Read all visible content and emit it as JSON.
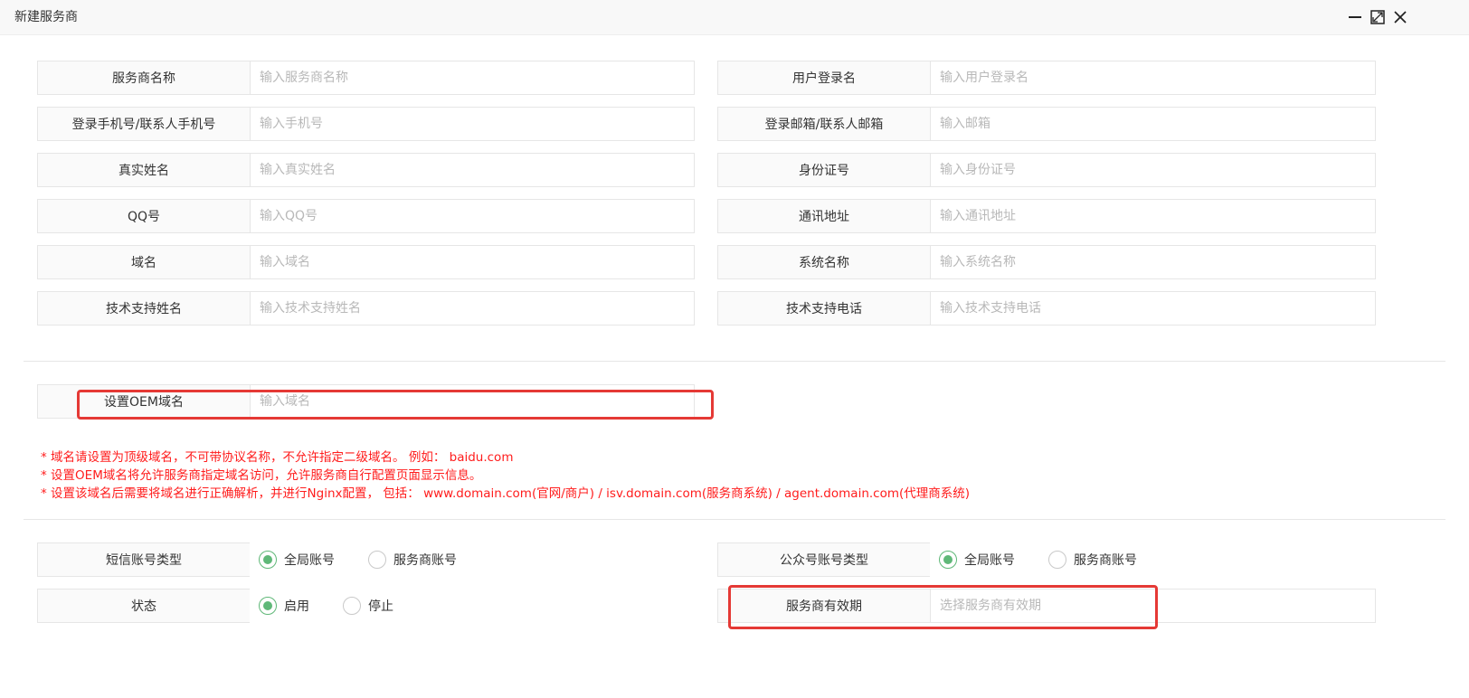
{
  "window": {
    "title": "新建服务商"
  },
  "form": {
    "rows": [
      {
        "left": {
          "label": "服务商名称",
          "placeholder": "输入服务商名称"
        },
        "right": {
          "label": "用户登录名",
          "placeholder": "输入用户登录名"
        }
      },
      {
        "left": {
          "label": "登录手机号/联系人手机号",
          "placeholder": "输入手机号"
        },
        "right": {
          "label": "登录邮箱/联系人邮箱",
          "placeholder": "输入邮箱"
        }
      },
      {
        "left": {
          "label": "真实姓名",
          "placeholder": "输入真实姓名"
        },
        "right": {
          "label": "身份证号",
          "placeholder": "输入身份证号"
        }
      },
      {
        "left": {
          "label": "QQ号",
          "placeholder": "输入QQ号"
        },
        "right": {
          "label": "通讯地址",
          "placeholder": "输入通讯地址"
        }
      },
      {
        "left": {
          "label": "域名",
          "placeholder": "输入域名"
        },
        "right": {
          "label": "系统名称",
          "placeholder": "输入系统名称"
        }
      },
      {
        "left": {
          "label": "技术支持姓名",
          "placeholder": "输入技术支持姓名"
        },
        "right": {
          "label": "技术支持电话",
          "placeholder": "输入技术支持电话"
        }
      }
    ],
    "oem": {
      "label": "设置OEM域名",
      "placeholder": "输入域名",
      "notes": [
        "* 域名请设置为顶级域名，不可带协议名称，不允许指定二级域名。 例如： baidu.com",
        "* 设置OEM域名将允许服务商指定域名访问，允许服务商自行配置页面显示信息。",
        "* 设置该域名后需要将域名进行正确解析，并进行Nginx配置， 包括： www.domain.com(官网/商户) / isv.domain.com(服务商系统) / agent.domain.com(代理商系统)"
      ]
    },
    "sms_type": {
      "label": "短信账号类型",
      "options": [
        "全局账号",
        "服务商账号"
      ],
      "selected": "全局账号"
    },
    "mp_type": {
      "label": "公众号账号类型",
      "options": [
        "全局账号",
        "服务商账号"
      ],
      "selected": "全局账号"
    },
    "status": {
      "label": "状态",
      "options": [
        "启用",
        "停止"
      ],
      "selected": "启用"
    },
    "expiry": {
      "label": "服务商有效期",
      "placeholder": "选择服务商有效期"
    }
  },
  "colors": {
    "accent": "#5fb878",
    "note": "#ff1c1c",
    "highlight": "#e53935",
    "border": "#e6e6e6",
    "label_bg": "#fafafa"
  },
  "icons": [
    "minimize-icon",
    "maximize-icon",
    "close-icon"
  ]
}
